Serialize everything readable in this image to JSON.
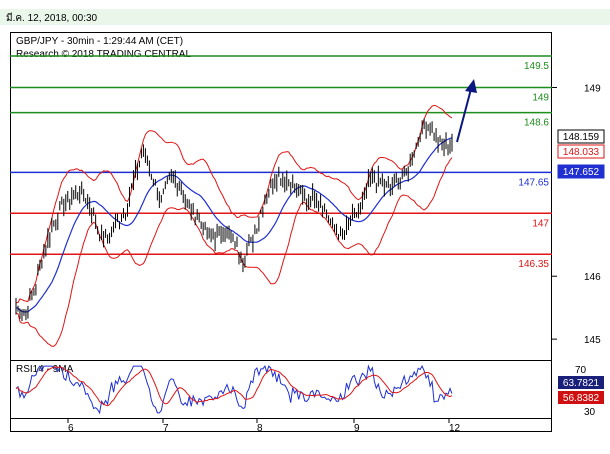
{
  "header": {
    "date_text": "มี.ค. 12, 2018, 00:30"
  },
  "chart_data": {
    "type": "line",
    "title": "GBP/JPY - 30min - 1:29:44 AM (CET)",
    "subtitle": "Research © 2018 TRADING CENTRAL",
    "price_ylim": [
      144.7,
      149.85
    ],
    "price_ticks": [
      "145",
      "146",
      "149"
    ],
    "x_tick_labels": [
      "6",
      "7",
      "8",
      "9",
      "12"
    ],
    "levels": [
      {
        "label": "149.5",
        "value": 149.5,
        "color": "#1e8c1e"
      },
      {
        "label": "149",
        "value": 149.0,
        "color": "#1e8c1e"
      },
      {
        "label": "148.6",
        "value": 148.6,
        "color": "#1e8c1e"
      },
      {
        "label": "147.65",
        "value": 147.65,
        "color": "#1f2fd0"
      },
      {
        "label": "147",
        "value": 147.0,
        "color": "#e01515"
      },
      {
        "label": "146.35",
        "value": 146.35,
        "color": "#e01515"
      }
    ],
    "price_badges": [
      {
        "label": "148.159",
        "value": 148.159,
        "bg": "#ffffff",
        "fg": "#000000",
        "border": "#000000"
      },
      {
        "label": "148.033",
        "value": 148.033,
        "bg": "#ffffff",
        "fg": "#e01515",
        "border": "#e01515"
      },
      {
        "label": "147.652",
        "value": 147.652,
        "bg": "#1f2fd0",
        "fg": "#ffffff",
        "border": "#1f2fd0"
      }
    ],
    "price_path": [
      [
        "6-",
        145.5
      ],
      [
        "6-",
        145.4
      ],
      [
        "6-",
        145.75
      ],
      [
        "6-",
        146.35
      ],
      [
        "6-",
        146.8
      ],
      [
        "6-",
        147.1
      ],
      [
        "6-",
        147.25
      ],
      [
        "6-",
        147.35
      ],
      [
        "6-",
        147.2
      ],
      [
        "6-",
        146.75
      ],
      [
        "6",
        146.55
      ],
      [
        "6",
        146.85
      ],
      [
        "6",
        147.0
      ],
      [
        "6",
        147.55
      ],
      [
        "6",
        148.0
      ],
      [
        "6",
        147.6
      ],
      [
        "6",
        147.2
      ],
      [
        "6",
        147.6
      ],
      [
        "6",
        147.45
      ],
      [
        "7",
        147.1
      ],
      [
        "7",
        146.95
      ],
      [
        "7",
        146.7
      ],
      [
        "7",
        146.6
      ],
      [
        "7",
        146.75
      ],
      [
        "7",
        146.55
      ],
      [
        "7",
        146.3
      ],
      [
        "7",
        146.55
      ],
      [
        "7",
        147.05
      ],
      [
        "7",
        147.45
      ],
      [
        "8",
        147.6
      ],
      [
        "8",
        147.5
      ],
      [
        "8",
        147.35
      ],
      [
        "8",
        147.2
      ],
      [
        "8",
        147.3
      ],
      [
        "8",
        147.05
      ],
      [
        "8",
        146.75
      ],
      [
        "8",
        146.65
      ],
      [
        "8",
        146.9
      ],
      [
        "8",
        147.1
      ],
      [
        "9",
        147.55
      ],
      [
        "9",
        147.5
      ],
      [
        "9",
        147.4
      ],
      [
        "9",
        147.5
      ],
      [
        "9",
        147.65
      ],
      [
        "9",
        148.05
      ],
      [
        "9",
        148.45
      ],
      [
        "9",
        148.25
      ],
      [
        "12",
        148.05
      ],
      [
        "12",
        148.16
      ]
    ],
    "indicator": {
      "label": "RSI14 - 9MA",
      "ylim": [
        25,
        75
      ],
      "ticks": [
        "30",
        "70"
      ],
      "badges": [
        {
          "label": "63.7821",
          "value": 63.7821,
          "bg": "#1a1f7a",
          "fg": "#ffffff"
        },
        {
          "label": "56.8382",
          "value": 56.8382,
          "bg": "#d01010",
          "fg": "#ffffff"
        }
      ]
    },
    "colors": {
      "price": "#000000",
      "bollinger": "#e01515",
      "moving_average": "#1f2fd0",
      "rsi": "#1f2fd0",
      "rsi_ma": "#e01515",
      "arrow": "#0b1780"
    },
    "grid": false
  }
}
